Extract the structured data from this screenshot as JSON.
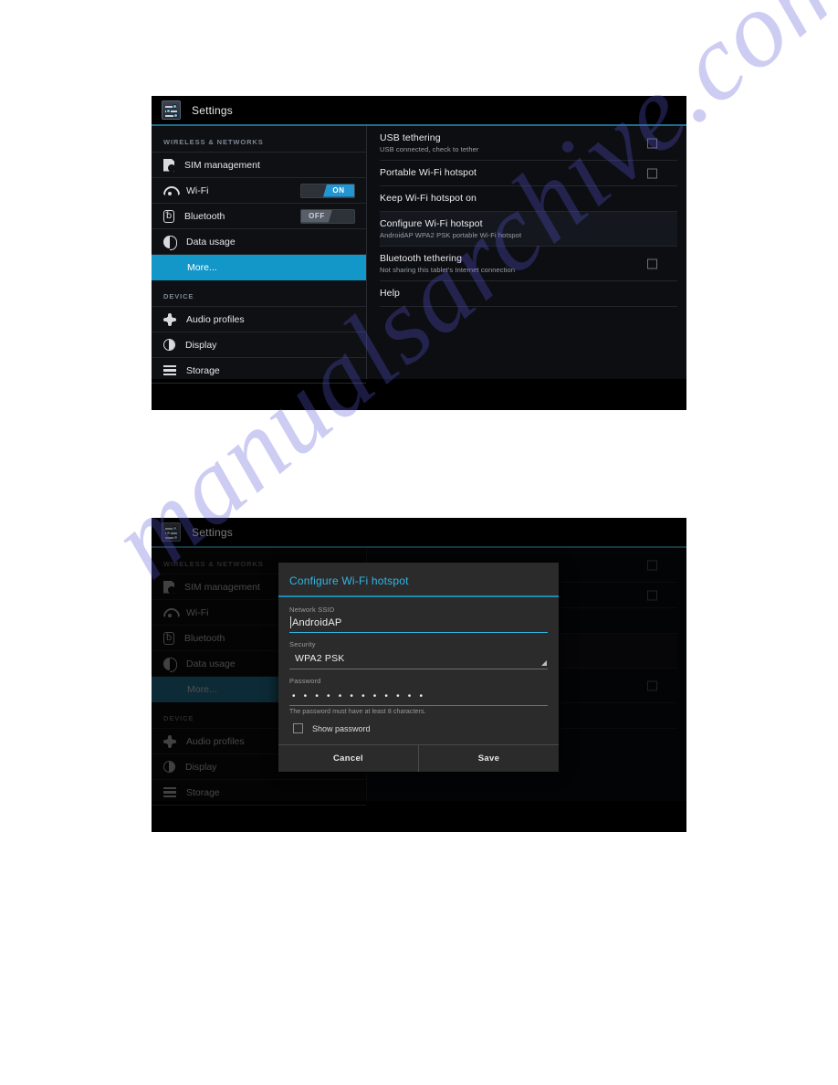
{
  "watermark": {
    "text": "manualsarchive.com"
  },
  "screenshot_one": {
    "statusbar": {
      "title": "Settings",
      "icon": "settings-sliders-icon"
    },
    "sidebar": {
      "groups": [
        {
          "header": "WIRELESS & NETWORKS",
          "items": [
            {
              "label": "SIM management",
              "icon": "sim-card-icon",
              "control": "none",
              "selected": false
            },
            {
              "label": "Wi-Fi",
              "icon": "wifi-icon",
              "control": "toggle",
              "toggle_state": "ON",
              "selected": false
            },
            {
              "label": "Bluetooth",
              "icon": "bluetooth-icon",
              "control": "toggle",
              "toggle_state": "OFF",
              "selected": false
            },
            {
              "label": "Data usage",
              "icon": "data-usage-pie-icon",
              "control": "none",
              "selected": false
            },
            {
              "label": "More...",
              "icon": "none",
              "control": "none",
              "selected": true
            }
          ]
        },
        {
          "header": "DEVICE",
          "items": [
            {
              "label": "Audio profiles",
              "icon": "audio-profiles-icon",
              "control": "none",
              "selected": false
            },
            {
              "label": "Display",
              "icon": "display-brightness-icon",
              "control": "none",
              "selected": false
            },
            {
              "label": "Storage",
              "icon": "storage-bars-icon",
              "control": "none",
              "selected": false
            }
          ]
        }
      ]
    },
    "prefs": [
      {
        "title": "USB tethering",
        "summary": "USB connected, check to tether",
        "checkbox": true,
        "checked": false,
        "highlight": false
      },
      {
        "title": "Portable Wi-Fi hotspot",
        "summary": "",
        "checkbox": true,
        "checked": false,
        "highlight": false
      },
      {
        "title": "Keep Wi-Fi hotspot on",
        "summary": "",
        "checkbox": false,
        "checked": false,
        "highlight": false
      },
      {
        "title": "Configure Wi-Fi hotspot",
        "summary": "AndroidAP WPA2 PSK portable Wi-Fi hotspot",
        "checkbox": false,
        "checked": false,
        "highlight": true
      },
      {
        "title": "Bluetooth tethering",
        "summary": "Not sharing this tablet's Internet connection",
        "checkbox": true,
        "checked": false,
        "highlight": false
      },
      {
        "title": "Help",
        "summary": "",
        "checkbox": false,
        "checked": false,
        "highlight": false
      }
    ]
  },
  "screenshot_two": {
    "statusbar": {
      "title": "Settings",
      "icon": "settings-sliders-icon"
    },
    "sidebar": {
      "groups": [
        {
          "header": "WIRELESS & NETWORKS",
          "items": [
            {
              "label": "SIM management",
              "icon": "sim-card-icon",
              "control": "none",
              "selected": false
            },
            {
              "label": "Wi-Fi",
              "icon": "wifi-icon",
              "control": "none",
              "selected": false
            },
            {
              "label": "Bluetooth",
              "icon": "bluetooth-icon",
              "control": "none",
              "selected": false
            },
            {
              "label": "Data usage",
              "icon": "data-usage-pie-icon",
              "control": "none",
              "selected": false
            },
            {
              "label": "More...",
              "icon": "none",
              "control": "none",
              "selected": true
            }
          ]
        },
        {
          "header": "DEVICE",
          "items": [
            {
              "label": "Audio profiles",
              "icon": "audio-profiles-icon",
              "control": "none",
              "selected": false
            },
            {
              "label": "Display",
              "icon": "display-brightness-icon",
              "control": "none",
              "selected": false
            },
            {
              "label": "Storage",
              "icon": "storage-bars-icon",
              "control": "none",
              "selected": false
            }
          ]
        }
      ]
    },
    "prefs": [
      {
        "title": "",
        "summary": "",
        "checkbox": true,
        "checked": false,
        "highlight": false
      },
      {
        "title": "",
        "summary": "",
        "checkbox": true,
        "checked": false,
        "highlight": false
      },
      {
        "title": "",
        "summary": "",
        "checkbox": false,
        "checked": false,
        "highlight": false
      },
      {
        "title": "",
        "summary": "",
        "checkbox": false,
        "checked": false,
        "highlight": true
      },
      {
        "title": "",
        "summary": "",
        "checkbox": true,
        "checked": false,
        "highlight": false
      },
      {
        "title": "",
        "summary": "",
        "checkbox": false,
        "checked": false,
        "highlight": false
      }
    ],
    "dialog": {
      "title": "Configure Wi-Fi hotspot",
      "ssid_label": "Network SSID",
      "ssid_value": "AndroidAP",
      "security_label": "Security",
      "security_value": "WPA2 PSK",
      "password_label": "Password",
      "password_masked": "• • • • • • • • • • • •",
      "password_hint": "The password must have at least 8 characters.",
      "show_password_label": "Show password",
      "show_password_checked": false,
      "cancel_label": "Cancel",
      "save_label": "Save"
    }
  },
  "colors": {
    "accent_blue": "#33b5e5",
    "selected_row": "#1397c9",
    "toggle_on": "#2196d3",
    "toggle_off": "#585f68",
    "panel_bg": "#0c0e12",
    "dialog_bg": "#2b2b2b",
    "watermark": "#5856d6"
  }
}
